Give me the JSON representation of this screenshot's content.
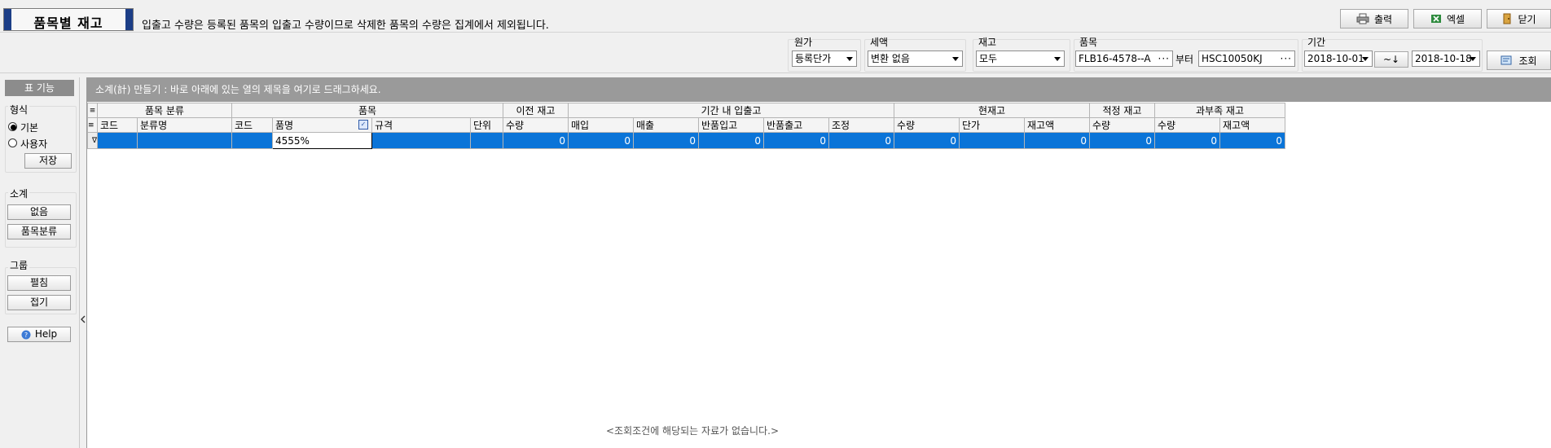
{
  "header": {
    "title": "품목별 재고",
    "notice": "입출고 수량은 등록된 품목의 입출고 수량이므로 삭제한 품목의 수량은 집계에서 제외됩니다."
  },
  "toolbar": {
    "print_label": "출력",
    "excel_label": "엑셀",
    "close_label": "닫기",
    "search_label": "조회"
  },
  "filters": {
    "cost_label": "원가",
    "cost_value": "등록단가",
    "tax_label": "세액",
    "tax_value": "변환 없음",
    "stock_label": "재고",
    "stock_value": "모두",
    "item_label": "품목",
    "item_from": "FLB16-4578--A",
    "item_to_label": "부터",
    "item_to": "HSC10050KJ",
    "period_label": "기간",
    "date_from": "2018-10-01",
    "range_btn": "~↓",
    "date_to": "2018-10-18"
  },
  "left_panel": {
    "header": "표 기능",
    "format_title": "형식",
    "radio_basic": "기본",
    "radio_user": "사용자",
    "save_btn": "저장",
    "subtotal_title": "소계",
    "none_btn": "없음",
    "category_btn": "품목분류",
    "group_title": "그룹",
    "expand_btn": "펼침",
    "collapse_btn": "접기",
    "help_btn": "Help"
  },
  "grid": {
    "grouping_hint": "소계(計) 만들기 : 바로 아래에 있는 열의 제목을 여기로 드래그하세요.",
    "group_headers": [
      "품목 분류",
      "품목",
      "이전 재고",
      "기간 내 입출고",
      "현재고",
      "적정 재고",
      "과부족 재고"
    ],
    "columns": [
      "코드",
      "분류명",
      "코드",
      "품명",
      "규격",
      "단위",
      "수량",
      "매입",
      "매출",
      "반품입고",
      "반품출고",
      "조정",
      "수량",
      "단가",
      "재고액",
      "수량",
      "수량",
      "재고액"
    ],
    "filter_row": [
      "",
      "",
      "",
      "4555%",
      "",
      "",
      "0",
      "0",
      "0",
      "0",
      "0",
      "0",
      "0",
      "",
      "0",
      "0",
      "0",
      "0"
    ],
    "empty_message": "<조회조건에 해당되는 자료가 없습니다.>"
  },
  "colors": {
    "title_bar": "#1c3e87",
    "selection": "#0a74d8",
    "grouping_bar": "#9a9a9a"
  }
}
